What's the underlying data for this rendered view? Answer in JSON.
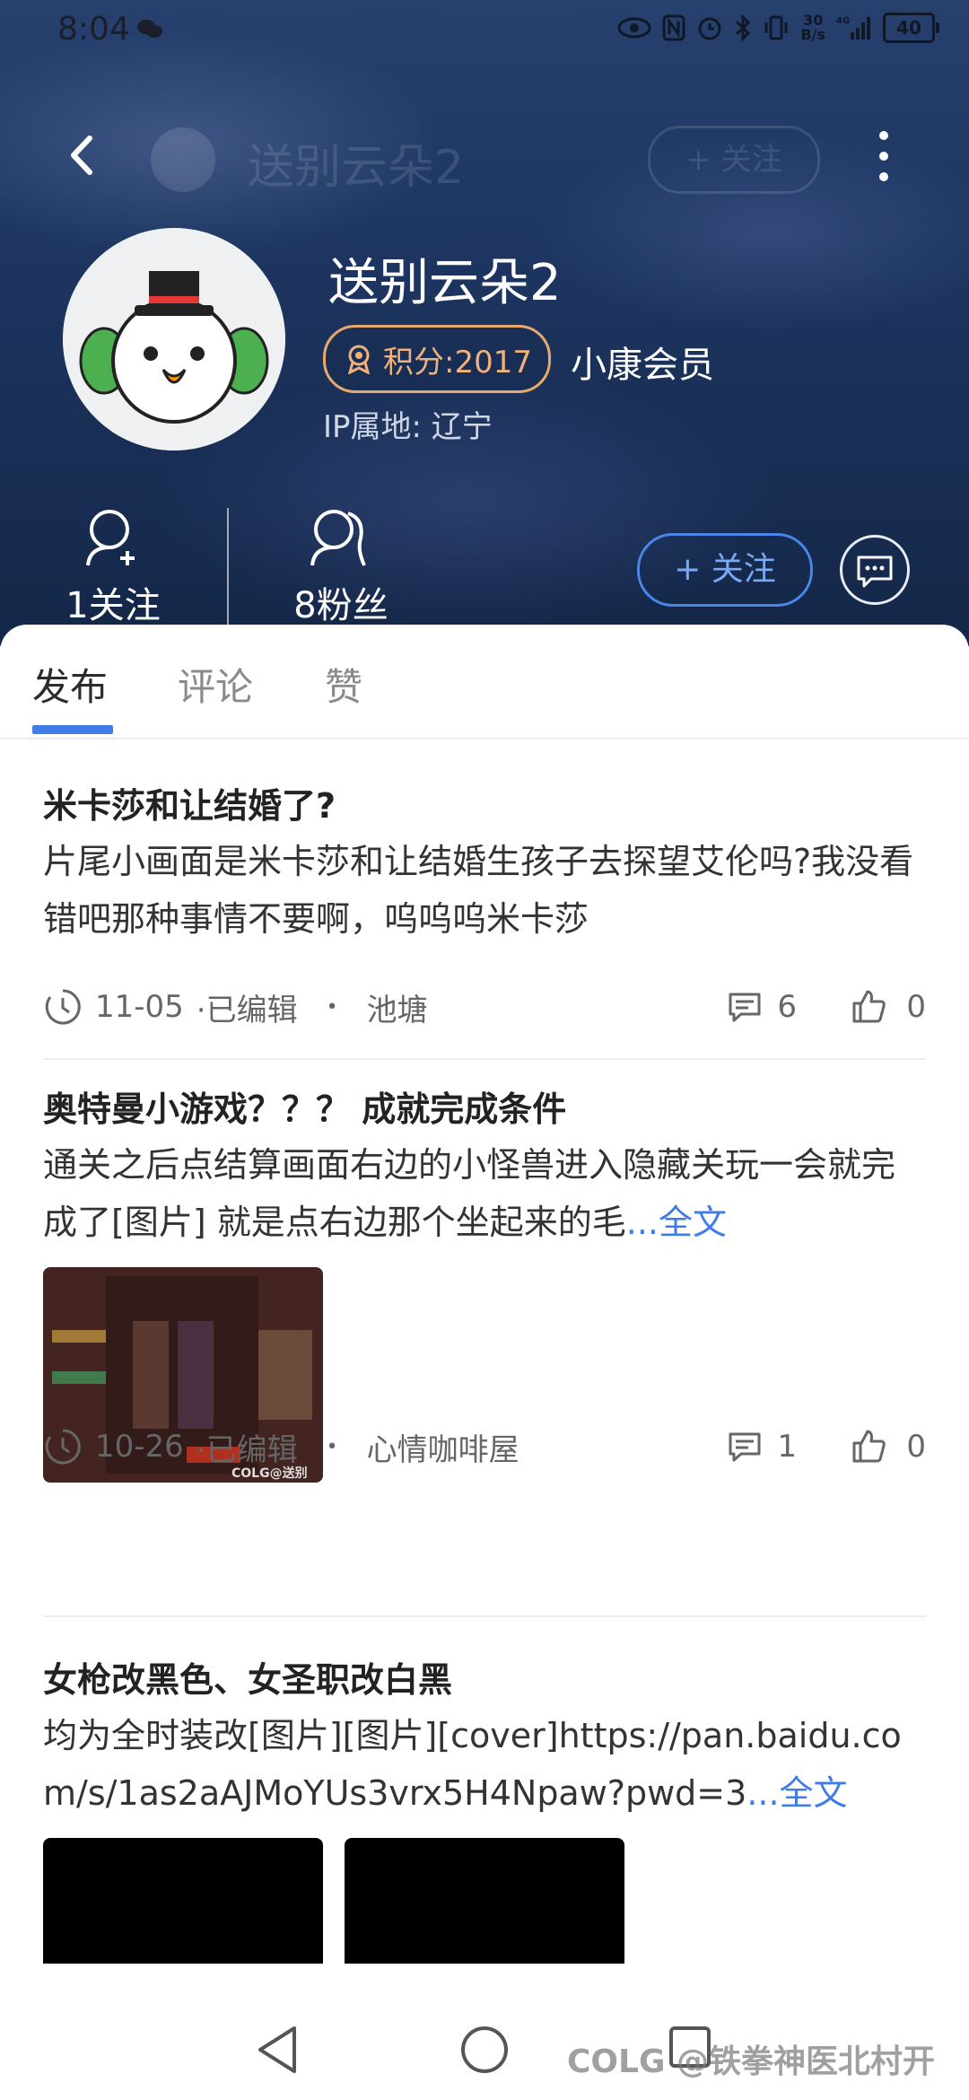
{
  "status_bar": {
    "time": "8:04",
    "net_speed": "30\nB/s",
    "net_speed_top": "30",
    "net_speed_bottom": "B/s",
    "network_type": "4G",
    "battery": "40"
  },
  "top_bar": {
    "ghost_title": "送别云朵2",
    "ghost_follow": "+ 关注"
  },
  "profile": {
    "username": "送别云朵2",
    "points_label": "积分:2017",
    "member_label": "小康会员",
    "ip_location": "IP属地: 辽宁",
    "following": "1关注",
    "followers": "8粉丝",
    "follow_button": "+ 关注"
  },
  "tabs": [
    {
      "label": "发布",
      "active": true
    },
    {
      "label": "评论",
      "active": false
    },
    {
      "label": "赞",
      "active": false
    }
  ],
  "posts": [
    {
      "title": "米卡莎和让结婚了?",
      "body": " 片尾小画面是米卡莎和让结婚生孩子去探望艾伦吗?我没看错吧那种事情不要啊，呜呜呜米卡莎",
      "body_more": "",
      "date": "11-05",
      "edited": "·已编辑",
      "dot": "•",
      "board": "池塘",
      "comments": "6",
      "likes": "0"
    },
    {
      "title": "奥特曼小游戏？？？ 成就完成条件",
      "body": " 通关之后点结算画面右边的小怪兽进入隐藏关玩一会就完成了[图片] 就是点右边那个坐起来的毛",
      "body_more": "...全文",
      "date": "10-26",
      "edited": "·已编辑",
      "dot": "•",
      "board": "心情咖啡屋",
      "comments": "1",
      "likes": "0"
    },
    {
      "title": "女枪改黑色、女圣职改白黑",
      "body": "均为全时装改[图片][图片][cover]https://pan.baidu.com/s/1as2aAJMoYUs3vrx5H4Npaw?pwd=3",
      "body_more": "...全文"
    }
  ],
  "watermark": "COLG @铁拳神医北村开",
  "colors": {
    "accent": "#3f7ce8",
    "points_gold": "#f0b27a",
    "header_bg": "#1d3560"
  }
}
